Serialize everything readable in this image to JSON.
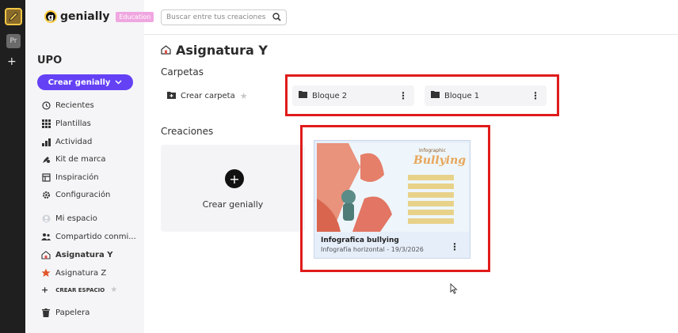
{
  "rail": {
    "second_ws_label": "Pr",
    "add_label": "+"
  },
  "sidebar": {
    "logo_text": "genially",
    "badge": "Education",
    "space_title": "UPO",
    "create_button": "Crear genially",
    "nav": {
      "recent": "Recientes",
      "templates": "Plantillas",
      "activity": "Actividad",
      "brand_kit": "Kit de marca",
      "inspiration": "Inspiración",
      "config": "Configuración",
      "my_space": "Mi espacio",
      "shared": "Compartido conmi...",
      "subject_y": "Asignatura Y",
      "subject_z": "Asignatura Z",
      "create_space": "CREAR ESPACIO",
      "trash": "Papelera"
    }
  },
  "topbar": {
    "search_placeholder": "Buscar entre tus creaciones"
  },
  "main": {
    "title": "Asignatura Y",
    "folders_heading": "Carpetas",
    "create_folder": "Crear carpeta",
    "folders": [
      "Bloque 2",
      "Bloque 1"
    ],
    "creations_heading": "Creaciones",
    "new_creation_label": "Crear genially",
    "creation": {
      "title": "Infografica bullying",
      "subtitle": "Infografía horizontal - 19/3/2026",
      "thumb_small": "Infographic",
      "thumb_big": "Bullying"
    }
  },
  "colors": {
    "accent": "#6441f5",
    "highlight": "#e01b1b",
    "rail": "#1f1f1f"
  }
}
